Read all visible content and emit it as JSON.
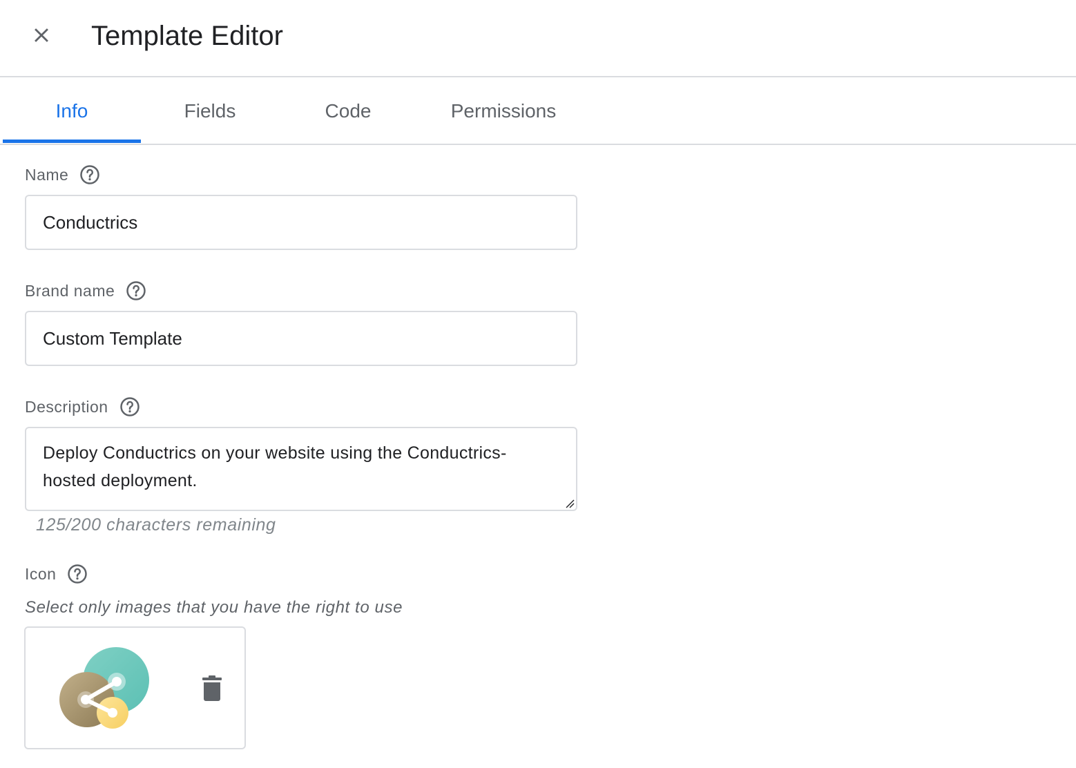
{
  "header": {
    "title": "Template Editor"
  },
  "tabs": [
    {
      "label": "Info",
      "active": true
    },
    {
      "label": "Fields",
      "active": false
    },
    {
      "label": "Code",
      "active": false
    },
    {
      "label": "Permissions",
      "active": false
    }
  ],
  "form": {
    "name": {
      "label": "Name",
      "value": "Conductrics"
    },
    "brand_name": {
      "label": "Brand name",
      "value": "Custom Template"
    },
    "description": {
      "label": "Description",
      "value": "Deploy Conductrics on your website using the Conductrics-hosted deployment.",
      "counter": "125/200 characters remaining"
    },
    "icon": {
      "label": "Icon",
      "hint": "Select only images that you have the right to use"
    }
  },
  "icons": {
    "close": "close-icon",
    "help": "help-circle-icon",
    "delete": "trash-icon",
    "template": "share-icon"
  },
  "colors": {
    "accent": "#1a73e8",
    "text_primary": "#202124",
    "text_secondary": "#5f6368",
    "border": "#dadce0"
  }
}
